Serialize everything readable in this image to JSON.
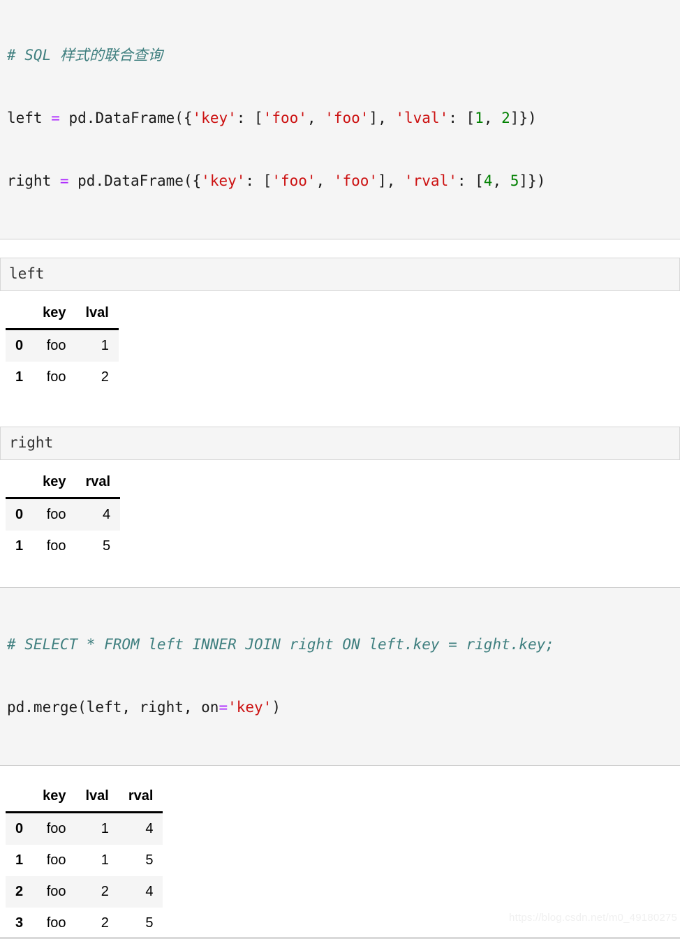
{
  "watermark": "https://blog.csdn.net/m0_49180275",
  "colors": {
    "comment": "#3f7f7f",
    "string": "#cc1111",
    "number": "#008000",
    "operator": "#aa22ff",
    "code_bg": "#f5f5f5",
    "row_alt_bg": "#f5f5f5",
    "border": "#cfcfcf"
  },
  "cells": {
    "code1": {
      "comment": "# SQL 样式的联合查询",
      "line2": {
        "a": "left ",
        "eq": "=",
        "b": " pd.DataFrame({",
        "s1": "'key'",
        "c": ": [",
        "s2": "'foo'",
        "d": ", ",
        "s3": "'foo'",
        "e": "], ",
        "s4": "'lval'",
        "f": ": [",
        "n1": "1",
        "g": ", ",
        "n2": "2",
        "h": "]})"
      },
      "line3": {
        "a": "right ",
        "eq": "=",
        "b": " pd.DataFrame({",
        "s1": "'key'",
        "c": ": [",
        "s2": "'foo'",
        "d": ", ",
        "s3": "'foo'",
        "e": "], ",
        "s4": "'rval'",
        "f": ": [",
        "n1": "4",
        "g": ", ",
        "n2": "5",
        "h": "]})"
      }
    },
    "out1_label": "left",
    "out2_label": "right",
    "code2": {
      "comment": "# SELECT * FROM left INNER JOIN right ON left.key = right.key;",
      "line2": {
        "a": "pd.merge(left, right, on",
        "eq": "=",
        "s1": "'key'",
        "b": ")"
      }
    }
  },
  "tables": {
    "left": {
      "index_header": "",
      "columns": [
        "key",
        "lval"
      ],
      "index": [
        "0",
        "1"
      ],
      "rows": [
        [
          "foo",
          "1"
        ],
        [
          "foo",
          "2"
        ]
      ]
    },
    "right": {
      "index_header": "",
      "columns": [
        "key",
        "rval"
      ],
      "index": [
        "0",
        "1"
      ],
      "rows": [
        [
          "foo",
          "4"
        ],
        [
          "foo",
          "5"
        ]
      ]
    },
    "merged": {
      "index_header": "",
      "columns": [
        "key",
        "lval",
        "rval"
      ],
      "index": [
        "0",
        "1",
        "2",
        "3"
      ],
      "rows": [
        [
          "foo",
          "1",
          "4"
        ],
        [
          "foo",
          "1",
          "5"
        ],
        [
          "foo",
          "2",
          "4"
        ],
        [
          "foo",
          "2",
          "5"
        ]
      ]
    }
  }
}
